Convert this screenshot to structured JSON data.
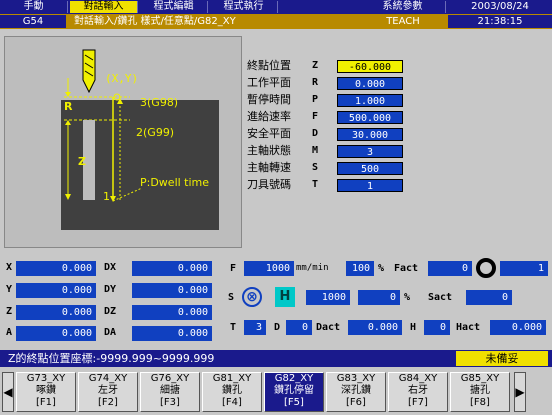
{
  "menu": {
    "items": [
      "手動",
      "對話輸入",
      "程式編輯",
      "程式執行"
    ],
    "right_item": "系統參數",
    "date": "2003/08/24"
  },
  "status": {
    "code": "G54",
    "path": "對話輸入/鑽孔 樣式/任意點/G82_XY",
    "mode": "TEACH",
    "time": "21:38:15"
  },
  "diagram": {
    "xy_label": "(X,Y)",
    "r_label": "R",
    "z_label": "Z",
    "g98_label": "3(G98)",
    "g99_label": "2(G99)",
    "dwell_label": "P:Dwell time",
    "point1": "1"
  },
  "params": [
    {
      "label": "終點位置",
      "letter": "Z",
      "value": "-60.000"
    },
    {
      "label": "工作平面",
      "letter": "R",
      "value": "0.000"
    },
    {
      "label": "暫停時間",
      "letter": "P",
      "value": "1.000"
    },
    {
      "label": "進給速率",
      "letter": "F",
      "value": "500.000"
    },
    {
      "label": "安全平面",
      "letter": "D",
      "value": "30.000"
    },
    {
      "label": "主軸狀態",
      "letter": "M",
      "value": "3"
    },
    {
      "label": "主軸轉速",
      "letter": "S",
      "value": "500"
    },
    {
      "label": "刀具號碼",
      "letter": "T",
      "value": "1"
    }
  ],
  "axes": [
    {
      "label": "X",
      "value": "0.000",
      "dlabel": "DX",
      "dvalue": "0.000"
    },
    {
      "label": "Y",
      "value": "0.000",
      "dlabel": "DY",
      "dvalue": "0.000"
    },
    {
      "label": "Z",
      "value": "0.000",
      "dlabel": "DZ",
      "dvalue": "0.000"
    },
    {
      "label": "A",
      "value": "0.000",
      "dlabel": "DA",
      "dvalue": "0.000"
    }
  ],
  "spindle": {
    "f_label": "F",
    "f_value": "1000",
    "f_unit": "mm/min",
    "f_pct": "100",
    "pct_sign": "%",
    "fact_label": "Fact",
    "fact_value": "0",
    "circle_value": "1",
    "s_label": "S",
    "h_label": "H",
    "s_value": "1000",
    "s_pct": "0",
    "sact_label": "Sact",
    "sact_value": "0",
    "t_label": "T",
    "t_value": "3",
    "d_label": "D",
    "d_value": "0",
    "dact_label": "Dact",
    "dact_value": "0.000",
    "h2_label": "H",
    "h2_value": "0",
    "hact_label": "Hact",
    "hact_value": "0.000"
  },
  "message": "Z的終點位置座標:-9999.999~9999.999",
  "ready": "未備妥",
  "softkeys": [
    {
      "code": "G73_XY",
      "name": "啄鑽",
      "key": "[F1]"
    },
    {
      "code": "G74_XY",
      "name": "左牙",
      "key": "[F2]"
    },
    {
      "code": "G76_XY",
      "name": "細搪",
      "key": "[F3]"
    },
    {
      "code": "G81_XY",
      "name": "鑽孔",
      "key": "[F4]"
    },
    {
      "code": "G82_XY",
      "name": "鑽孔停留",
      "key": "[F5]"
    },
    {
      "code": "G83_XY",
      "name": "深孔鑽",
      "key": "[F6]"
    },
    {
      "code": "G84_XY",
      "name": "右牙",
      "key": "[F7]"
    },
    {
      "code": "G85_XY",
      "name": "搪孔",
      "key": "[F8]"
    }
  ],
  "colors": {
    "menu_bg": "#1a1a8c",
    "highlight": "#f0e000",
    "field_bg": "#1040c0",
    "status_bg": "#b88a00"
  }
}
